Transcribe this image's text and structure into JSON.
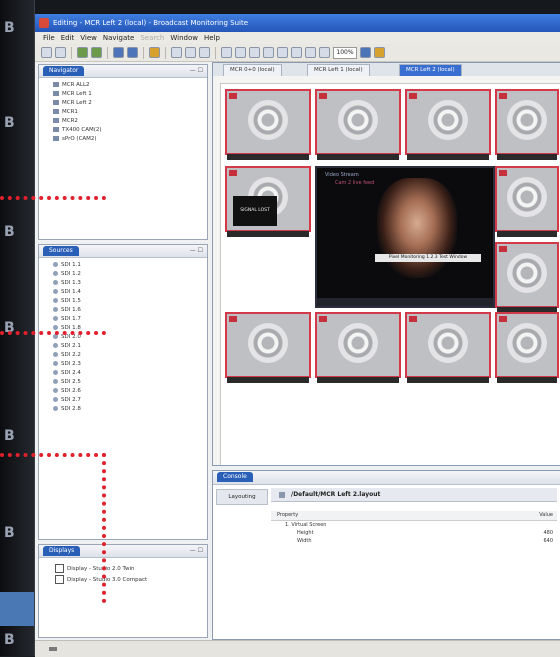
{
  "window": {
    "title": "Editing - MCR Left 2 (local) - Broadcast Monitoring Suite"
  },
  "menu": [
    "File",
    "Edit",
    "View",
    "Navigate",
    "Search",
    "Window",
    "Help"
  ],
  "toolbar": {
    "zoom": "100%"
  },
  "left_panes": {
    "navigator_tab": "Navigator",
    "layouts": [
      "MCR ALL2",
      "MCR Left 1",
      "MCR Left 2",
      "MCR1",
      "MCR2",
      "TX400 CAM(2)",
      "sPrO (CAM2)"
    ],
    "sources_tab": "Sources",
    "sources": [
      "SDI 1.1",
      "SDI 1.2",
      "SDI 1.3",
      "SDI 1.4",
      "SDI 1.5",
      "SDI 1.6",
      "SDI 1.7",
      "SDI 1.8",
      "SDI 2.0",
      "SDI 2.1",
      "SDI 2.2",
      "SDI 2.3",
      "SDI 2.4",
      "SDI 2.5",
      "SDI 2.6",
      "SDI 2.7",
      "SDI 2.8"
    ],
    "displays_tab": "Displays",
    "displays": [
      "Display - Studio 2.0 Twin",
      "Display - Studio 3.0 Compact"
    ]
  },
  "editor": {
    "tabs": [
      "MCR 0+0 (local)",
      "MCR Left 1 (local)",
      "MCR Left 2 (local)"
    ],
    "active_tab": "MCR Left 2 (local)",
    "video_title": "Video Stream",
    "video_sub": "Cam 2 live feed",
    "video_caption": "Pixel Monitoring 1.2.3 Test Window",
    "blackbox_label": "SIGNAL LOST"
  },
  "console": {
    "tab": "Console",
    "left_label": "Layouting",
    "path": "/Default/MCR Left 2.layout",
    "columns": [
      "Property",
      "Value"
    ],
    "rows": [
      {
        "label": "1. Virtual Screen",
        "value": "",
        "indent": 1
      },
      {
        "label": "Height",
        "value": "480",
        "indent": 2
      },
      {
        "label": "Width",
        "value": "640",
        "indent": 2
      }
    ]
  },
  "colors": {
    "accent": "#2a5fb8",
    "callout": "#e0202c",
    "tile_border": "#d23a4a"
  },
  "icons": [
    "app-icon",
    "folder-icon",
    "source-icon",
    "checkbox-icon"
  ]
}
